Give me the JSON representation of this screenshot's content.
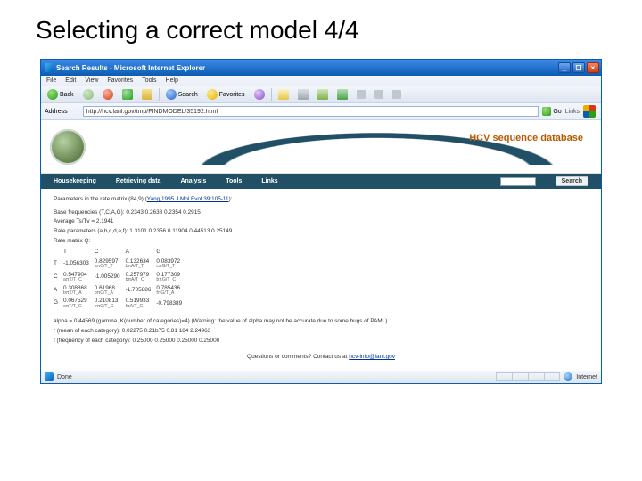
{
  "slide": {
    "title": "Selecting a correct model 4/4"
  },
  "window": {
    "title": "Search Results - Microsoft Internet Explorer",
    "min": "_",
    "max": "☐",
    "close": "×"
  },
  "menu": {
    "file": "File",
    "edit": "Edit",
    "view": "View",
    "favorites": "Favorites",
    "tools": "Tools",
    "help": "Help"
  },
  "toolbar": {
    "back": "Back",
    "search": "Search",
    "favorites": "Favorites"
  },
  "address": {
    "label": "Address",
    "url": "http://hcv.lanl.gov/tmp/FINDMODEL/35192.html",
    "go": "Go",
    "links": "Links"
  },
  "site": {
    "title": "HCV sequence database",
    "nav": {
      "house": "Housekeeping",
      "retrieve": "Retrieving data",
      "analysis": "Analysis",
      "tools": "Tools",
      "links": "Links",
      "search": "Search"
    }
  },
  "page": {
    "params_prefix": "Parameters in the rate matrix (84,9) (",
    "params_link": "Yang,1995 J.Mol.Evol.39:105-11",
    "params_suffix": "):",
    "base_freq": "Base frequencies (T,C,A,G): 0.2343 0.2638 0.2354 0.2915",
    "ts_tv": "Average Ts/Tv = 2.1941",
    "rate_params": "Rate parameters (a,b,c,d,e,f): 1.3101 0.2356 0.11904 0.44513 0.25149",
    "q_label": "Rate matrix Q:",
    "q": {
      "headers": [
        "T",
        "C",
        "A",
        "G"
      ],
      "rows": [
        {
          "label": "T",
          "vals": [
            "-1.056303",
            "0.829597",
            "0.132634",
            "0.083972"
          ],
          "subs": [
            "",
            "aπC/T_T",
            "bπA/T_T",
            "cπG/T_T"
          ]
        },
        {
          "label": "C",
          "vals": [
            "0.547904",
            "-1.005290",
            "0.257979",
            "0.177309"
          ],
          "subs": [
            "aπT/T_C",
            "",
            "bπA/T_C",
            "bπG/T_C"
          ]
        },
        {
          "label": "A",
          "vals": [
            "0.308868",
            "0.61968",
            "-1.705886",
            "0.785436"
          ],
          "subs": [
            "bπT/T_A",
            "bπC/T_A",
            "",
            "fπG/T_A"
          ]
        },
        {
          "label": "G",
          "vals": [
            "0.067529",
            "0.210813",
            "0.519933",
            "-0.798389"
          ],
          "subs": [
            "cπT/T_G",
            "eπC/T_G",
            "fπA/T_G",
            ""
          ]
        }
      ]
    },
    "alpha": "alpha = 0.44569 (gamma, K(number of categories)=4) (Warning: the value of alpha may not be accurate due to some bugs of PAML)",
    "rmean": "r (mean of each category): 0.02275 0.21b75 0.81 184 2.24963",
    "freq_cat": "f (frequency of each category): 0.25000 0.25000 0.25000 0.25000",
    "footer_prefix": "Questions or comments? Contact us at ",
    "footer_link": "hcv-info@lanl.gov"
  },
  "status": {
    "done": "Done",
    "internet": "Internet"
  }
}
